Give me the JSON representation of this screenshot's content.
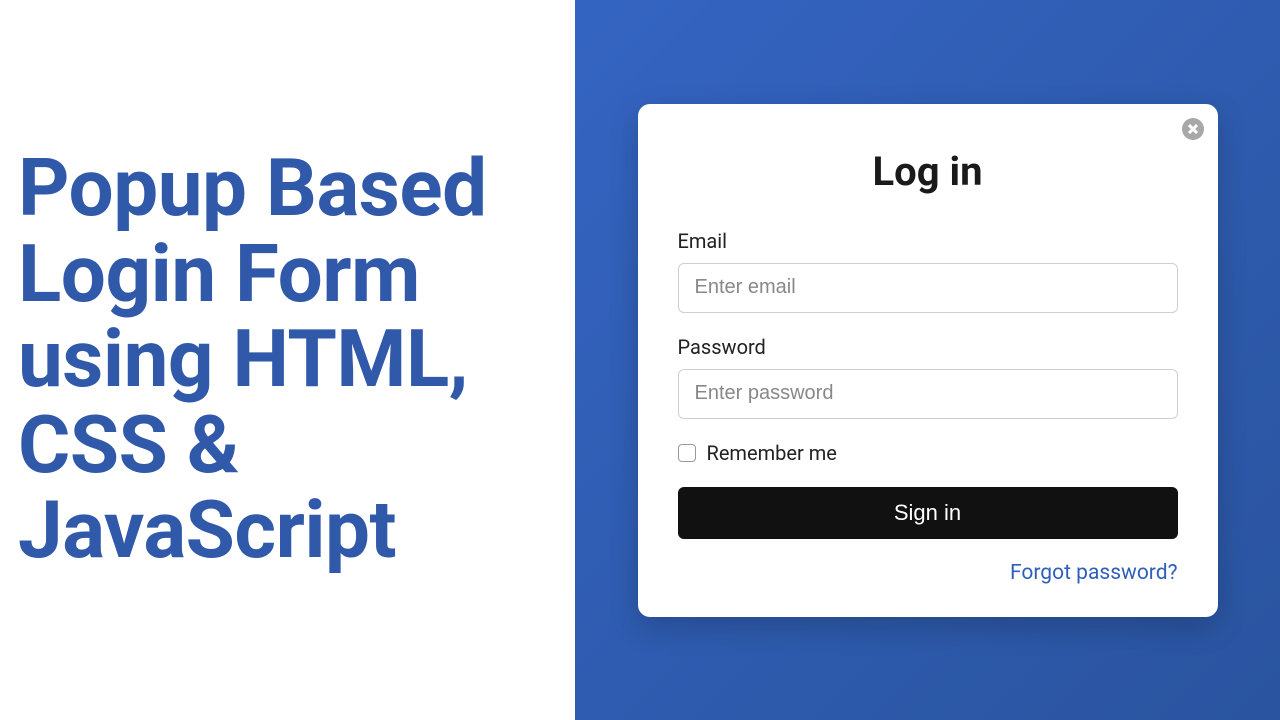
{
  "hero": {
    "title": "Popup Based Login Form using HTML, CSS & JavaScript"
  },
  "login": {
    "title": "Log in",
    "email": {
      "label": "Email",
      "placeholder": "Enter email",
      "value": ""
    },
    "password": {
      "label": "Password",
      "placeholder": "Enter password",
      "value": ""
    },
    "remember": {
      "label": "Remember me",
      "checked": false
    },
    "submit_label": "Sign in",
    "forgot_label": "Forgot password?"
  }
}
